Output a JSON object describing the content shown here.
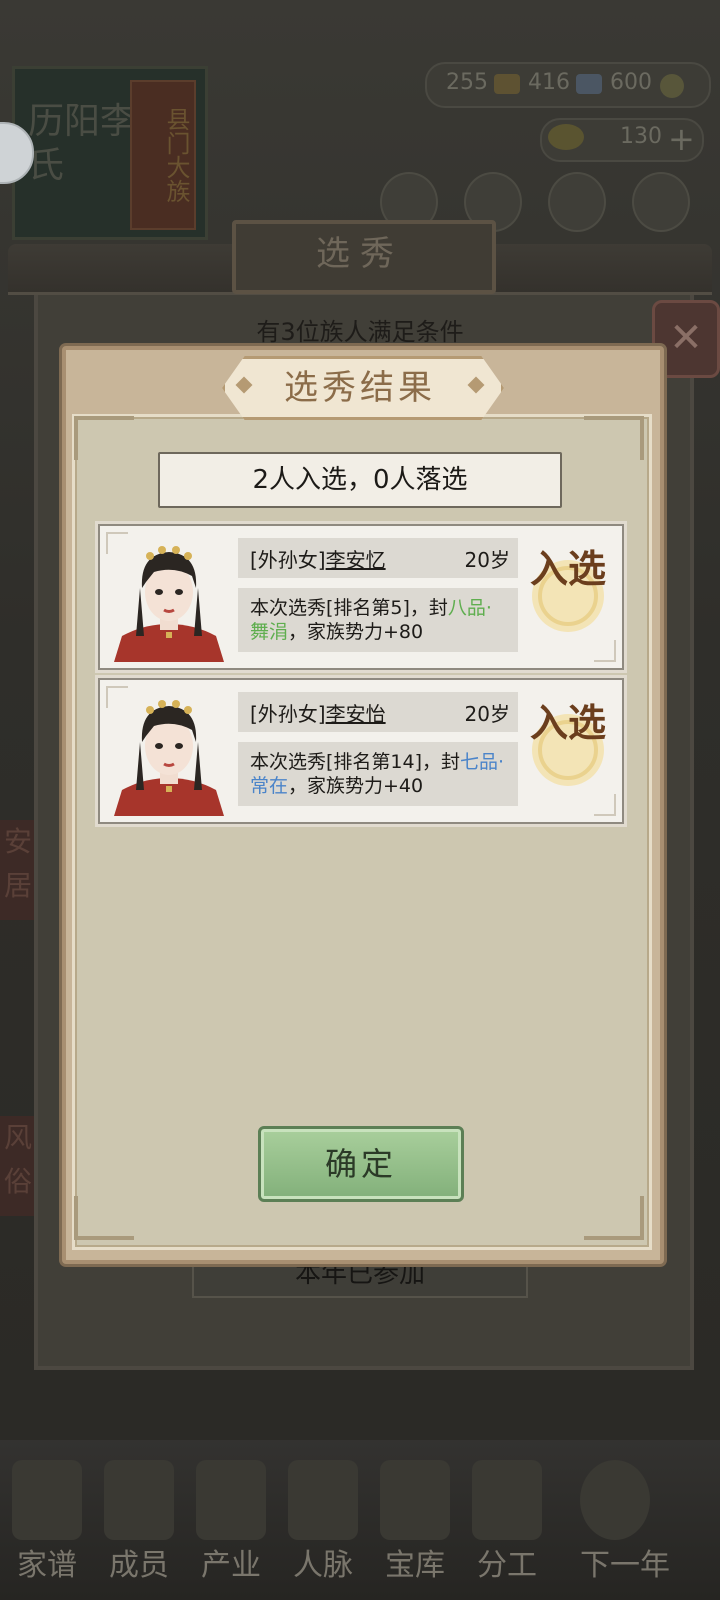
{
  "background": {
    "resources": {
      "copper": "255",
      "silver": "416",
      "coins": "600",
      "gold": "130"
    },
    "book": {
      "title": "历阳李氏",
      "subtitle": "县门大族"
    },
    "panel_title": "选秀",
    "eligible_text": "有3位族人满足条件",
    "year_status": "本年已参加",
    "nav_items": [
      "家谱",
      "成员",
      "产业",
      "人脉",
      "宝库",
      "分工",
      "下一年"
    ]
  },
  "modal": {
    "title": "选秀结果",
    "summary": "2人入选，0人落选",
    "results": [
      {
        "relation": "[外孙女]",
        "name": "李安忆",
        "age": "20岁",
        "desc_prefix": "本次选秀[排名第5]，封",
        "rank_title": "八品·舞涓",
        "desc_suffix": "，家族势力+80",
        "rank_color": "#5fae4f",
        "status": "入选"
      },
      {
        "relation": "[外孙女]",
        "name": "李安怡",
        "age": "20岁",
        "desc_prefix": "本次选秀[排名第14]，封",
        "rank_title": "七品·常在",
        "desc_suffix": "，家族势力+40",
        "rank_color": "#4b84c9",
        "status": "入选"
      }
    ],
    "confirm_label": "确定"
  }
}
